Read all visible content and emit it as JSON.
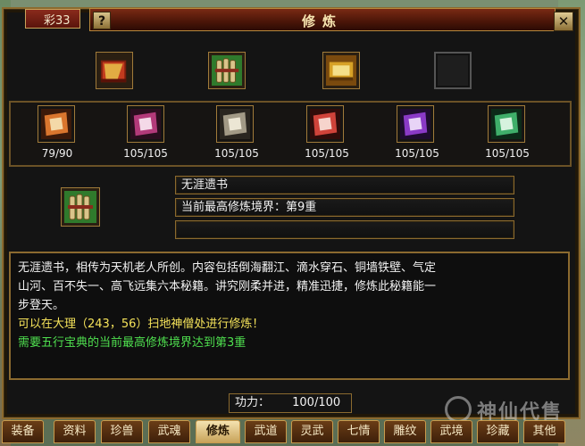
{
  "side_tab": {
    "label": "彩33"
  },
  "window": {
    "title": "修炼",
    "help_label": "?",
    "close_label": "✕"
  },
  "books": [
    {
      "name": "book-slot-1",
      "colors": [
        "#c23b1e",
        "#e8c14a"
      ]
    },
    {
      "name": "book-slot-2",
      "colors": [
        "#2f7a2c",
        "#d9c48a"
      ]
    },
    {
      "name": "book-slot-3",
      "colors": [
        "#d7a126",
        "#f4e08a"
      ]
    },
    {
      "name": "book-slot-4-empty",
      "colors": []
    }
  ],
  "scrolls": [
    {
      "count": "79/90",
      "color": "#d9762e"
    },
    {
      "count": "105/105",
      "color": "#b33a7a"
    },
    {
      "count": "105/105",
      "color": "#a29a86"
    },
    {
      "count": "105/105",
      "color": "#d0433a"
    },
    {
      "count": "105/105",
      "color": "#8a3ac6"
    },
    {
      "count": "105/105",
      "color": "#3fae6a"
    }
  ],
  "detail": {
    "book_name": "无涯遗书",
    "realm": "当前最高修炼境界：第9重",
    "extra": ""
  },
  "description": {
    "lines_white": [
      "无涯遗书，相传为天机老人所创。内容包括倒海翻江、滴水穿石、铜墙铁壁、气定",
      "山河、百不失一、高飞远集六本秘籍。讲究刚柔并进，精准迅捷，修炼此秘籍能一",
      "步登天。"
    ],
    "line_yellow": "可以在大理（243，56）扫地神僧处进行修炼！",
    "line_green": "需要五行宝典的当前最高修炼境界达到第3重"
  },
  "power": {
    "label": "功力：",
    "value": "100/100"
  },
  "tabs": [
    "装备",
    "资料",
    "珍兽",
    "武魂",
    "修炼",
    "武道",
    "灵武",
    "七情",
    "雕纹",
    "武境",
    "珍藏",
    "其他"
  ],
  "active_tab": "修炼",
  "watermark": "神仙代售"
}
